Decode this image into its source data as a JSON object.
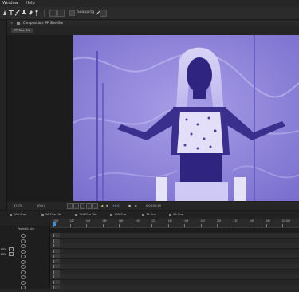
{
  "menubar": {
    "items": [
      "Window",
      "Help"
    ]
  },
  "toolbar": {
    "snapping_label": "Snapping"
  },
  "composition": {
    "panel_title": "Composition: PP Size Ofe",
    "comp_chip": "PP Size Ofe"
  },
  "viewer_bar": {
    "zoom": "67.7%",
    "quality": "(Full)",
    "exposure": "+0.0",
    "timecode": "0;00;00;00"
  },
  "timeline_tabs": [
    "10ft Size",
    "56 Size Ofe",
    "12ft Size Ofe",
    "10ft Size",
    "7ft Size",
    "5ft Size"
  ],
  "timeline": {
    "column_header": "Parent & Link",
    "color_labels": [
      "Lime",
      "Lime"
    ],
    "ruler_labels": [
      ":00f",
      "02f",
      "04f",
      "06f",
      "08f",
      "10f",
      "12f",
      "14f",
      "16f",
      "18f",
      "20f",
      "22f",
      "24f",
      "26f",
      "01:00f"
    ],
    "layer_count": 11
  },
  "image": {
    "description_colors": {
      "tint": "#8b7fd6",
      "dark": "#2a2175",
      "light": "#cfc9f5"
    }
  }
}
